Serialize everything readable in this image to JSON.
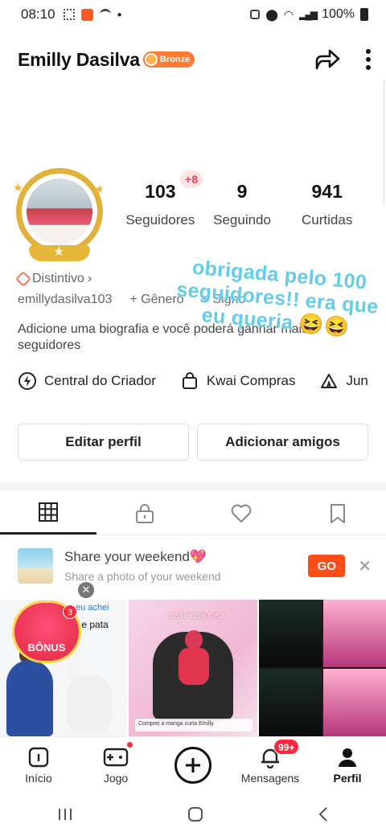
{
  "status_bar": {
    "time": "08:10",
    "battery": "100%"
  },
  "header": {
    "name": "Emilly Dasilva",
    "level_badge": "Bronze"
  },
  "stats": {
    "followers_new": "+8",
    "followers": "103",
    "followers_label": "Seguidores",
    "following": "9",
    "following_label": "Seguindo",
    "likes": "941",
    "likes_label": "Curtidas"
  },
  "profile": {
    "distintivo_label": "Distintivo",
    "username": "emillydasilva103",
    "gender_label": "+ Gênero",
    "sign_label": "+ Signo",
    "bio_placeholder": "Adicione uma biografia e você poderá ganhar mais seguidores"
  },
  "sticker": {
    "text": "obrigada pelo 100 seguidores!! era que eu queria 😆😆"
  },
  "tools": {
    "creator": "Central do Criador",
    "shop": "Kwai Compras",
    "more": "Jun"
  },
  "buttons": {
    "edit_profile": "Editar perfil",
    "add_friends": "Adicionar amigos"
  },
  "share": {
    "title": "Share your weekend💖",
    "subtitle": "Share a photo of your weekend",
    "go": "GO"
  },
  "grid": {
    "bonus_label": "BÔNUS",
    "bonus_count": "3",
    "cell1_caption": "eu achei",
    "cell1_caption2": "ta e pata",
    "cell2_label": "tralhados rosa",
    "cell2_banner": "Comprei a manga curta Emilly"
  },
  "bottom_nav": {
    "home": "Início",
    "game": "Jogo",
    "messages": "Mensagens",
    "messages_badge": "99+",
    "profile": "Perfil"
  }
}
